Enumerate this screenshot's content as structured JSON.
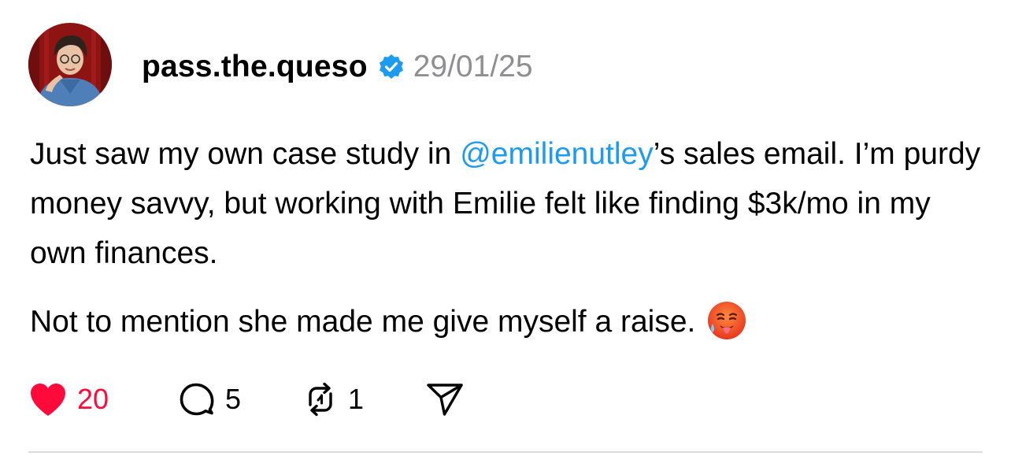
{
  "post": {
    "username": "pass.the.queso",
    "verified": true,
    "timestamp": "29/01/25",
    "text_segments": {
      "p1_before_mention": "Just saw my own case study in ",
      "mention": "@emilienutley",
      "p1_after_mention": "’s sales email. I’m purdy money savvy, but working with Emilie felt like finding $3k/mo in my own finances.",
      "p2": "Not to mention she made me give myself a raise."
    },
    "emoji": "hot-face-emoji",
    "actions": {
      "likes": "20",
      "replies": "5",
      "reposts": "1"
    },
    "icons": {
      "like": "heart-icon",
      "reply": "comment-icon",
      "repost": "repost-icon",
      "share": "send-icon",
      "verified": "verified-badge-icon"
    },
    "colors": {
      "like": "#ff0a3a",
      "mention": "#1d9bf0",
      "verified": "#1d9bf0",
      "timestamp": "#8e8e93"
    }
  }
}
